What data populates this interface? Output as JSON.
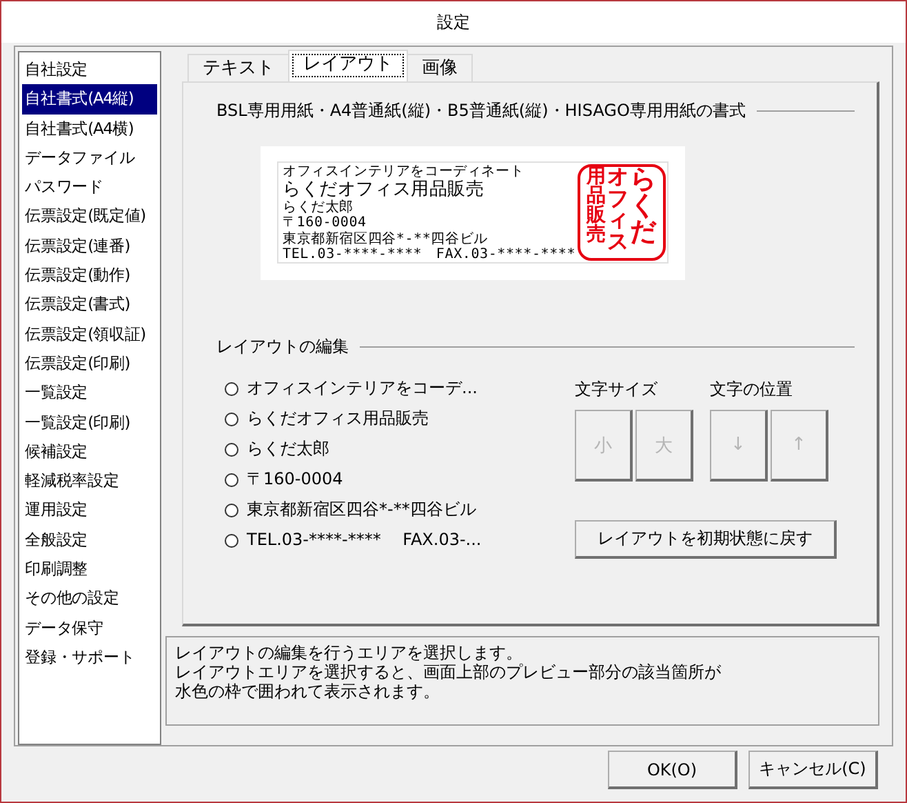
{
  "window": {
    "title": "設定"
  },
  "sidebar": {
    "items": [
      {
        "label": "自社設定",
        "selected": false
      },
      {
        "label": "自社書式(A4縦)",
        "selected": true
      },
      {
        "label": "自社書式(A4横)",
        "selected": false
      },
      {
        "label": "データファイル",
        "selected": false
      },
      {
        "label": "パスワード",
        "selected": false
      },
      {
        "label": "伝票設定(既定値)",
        "selected": false
      },
      {
        "label": "伝票設定(連番)",
        "selected": false
      },
      {
        "label": "伝票設定(動作)",
        "selected": false
      },
      {
        "label": "伝票設定(書式)",
        "selected": false
      },
      {
        "label": "伝票設定(領収証)",
        "selected": false
      },
      {
        "label": "伝票設定(印刷)",
        "selected": false
      },
      {
        "label": "一覧設定",
        "selected": false
      },
      {
        "label": "一覧設定(印刷)",
        "selected": false
      },
      {
        "label": "候補設定",
        "selected": false
      },
      {
        "label": "軽減税率設定",
        "selected": false
      },
      {
        "label": "運用設定",
        "selected": false
      },
      {
        "label": "全般設定",
        "selected": false
      },
      {
        "label": "印刷調整",
        "selected": false
      },
      {
        "label": "その他の設定",
        "selected": false
      },
      {
        "label": "データ保守",
        "selected": false
      },
      {
        "label": "登録・サポート",
        "selected": false
      }
    ]
  },
  "tabs": [
    {
      "label": "テキスト",
      "selected": false
    },
    {
      "label": "レイアウト",
      "selected": true
    },
    {
      "label": "画像",
      "selected": false
    }
  ],
  "preview": {
    "title": "BSL専用用紙・A4普通紙(縦)・B5普通紙(縦)・HISAGO専用用紙の書式",
    "lines": [
      {
        "text": "オフィスインテリアをコーディネート",
        "kind": "normal"
      },
      {
        "text": "らくだオフィス用品販売",
        "kind": "large"
      },
      {
        "text": "らくだ太郎",
        "kind": "normal"
      },
      {
        "text": "〒160-0004",
        "kind": "normal"
      },
      {
        "text": "東京都新宿区四谷*-**四谷ビル",
        "kind": "normal"
      },
      {
        "text": "TEL.03-****-****　FAX.03-****-****",
        "kind": "normal"
      }
    ],
    "stamp": {
      "columns": [
        "用品販売",
        "オフィス",
        "らくだ"
      ],
      "color": "#e60012"
    }
  },
  "layout_edit": {
    "title": "レイアウトの編集",
    "areas": [
      {
        "label": "オフィスインテリアをコーデ...",
        "selected": false
      },
      {
        "label": "らくだオフィス用品販売",
        "selected": false
      },
      {
        "label": "らくだ太郎",
        "selected": false
      },
      {
        "label": "〒160-0004",
        "selected": false
      },
      {
        "label": "東京都新宿区四谷*-**四谷ビル",
        "selected": false
      },
      {
        "label": "TEL.03-****-****　 FAX.03-...",
        "selected": false
      }
    ],
    "size_label": "文字サイズ",
    "size_buttons": [
      {
        "label": "小",
        "disabled": true
      },
      {
        "label": "大",
        "disabled": true
      }
    ],
    "position_label": "文字の位置",
    "position_buttons": [
      {
        "label": "↓",
        "disabled": true
      },
      {
        "label": "↑",
        "disabled": true
      }
    ],
    "reset_button": "レイアウトを初期状態に戻す"
  },
  "description": [
    "レイアウトの編集を行うエリアを選択します。",
    "レイアウトエリアを選択すると、画面上部のプレビュー部分の該当箇所が",
    "水色の枠で囲われて表示されます。"
  ],
  "buttons": [
    "OK(O)",
    "キャンセル(C)"
  ]
}
